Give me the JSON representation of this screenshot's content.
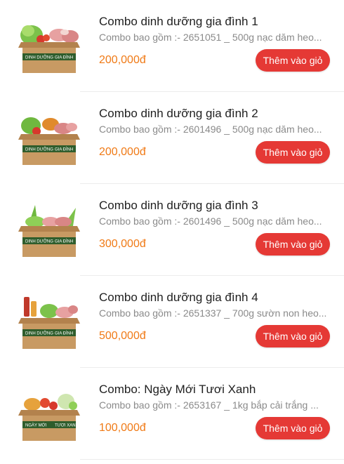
{
  "colors": {
    "price": "#f07a16",
    "button": "#e53935",
    "box": "#c89a63",
    "band": "#2f5d2c"
  },
  "products": [
    {
      "name": "Combo dinh dưỡng gia đình 1",
      "description": "Combo bao gồm :- 2651051 _ 500g nạc dăm heo...",
      "price": "200,000đ",
      "button_label": "Thêm vào giỏ",
      "image": {
        "icon": "produce-box-icon",
        "band_left": "DINH DƯỠNG",
        "band_right": "GIA ĐÌNH"
      }
    },
    {
      "name": "Combo dinh dưỡng gia đình 2",
      "description": "Combo bao gồm :- 2601496 _ 500g nạc dăm heo...",
      "price": "200,000đ",
      "button_label": "Thêm vào giỏ",
      "image": {
        "icon": "produce-box-icon",
        "band_left": "DINH DƯỠNG",
        "band_right": "GIA ĐÌNH"
      }
    },
    {
      "name": "Combo dinh dưỡng gia đình 3",
      "description": "Combo bao gồm :- 2601496 _ 500g nạc dăm heo...",
      "price": "300,000đ",
      "button_label": "Thêm vào giỏ",
      "image": {
        "icon": "produce-box-icon",
        "band_left": "DINH DƯỠNG",
        "band_right": "GIA ĐÌNH"
      }
    },
    {
      "name": "Combo dinh dưỡng gia đình 4",
      "description": "Combo bao gồm :- 2651337 _ 700g sườn non heo...",
      "price": "500,000đ",
      "button_label": "Thêm vào giỏ",
      "image": {
        "icon": "produce-box-icon",
        "band_left": "DINH DƯỠNG",
        "band_right": "GIA ĐÌNH"
      }
    },
    {
      "name": "Combo: Ngày Mới Tươi Xanh",
      "description": "Combo bao gồm :- 2653167 _ 1kg bắp cải trắng ...",
      "price": "100,000đ",
      "button_label": "Thêm vào giỏ",
      "image": {
        "icon": "produce-box-icon",
        "band_left": "NGÀY MỚI",
        "band_right": "TƯƠI XANH"
      }
    }
  ]
}
